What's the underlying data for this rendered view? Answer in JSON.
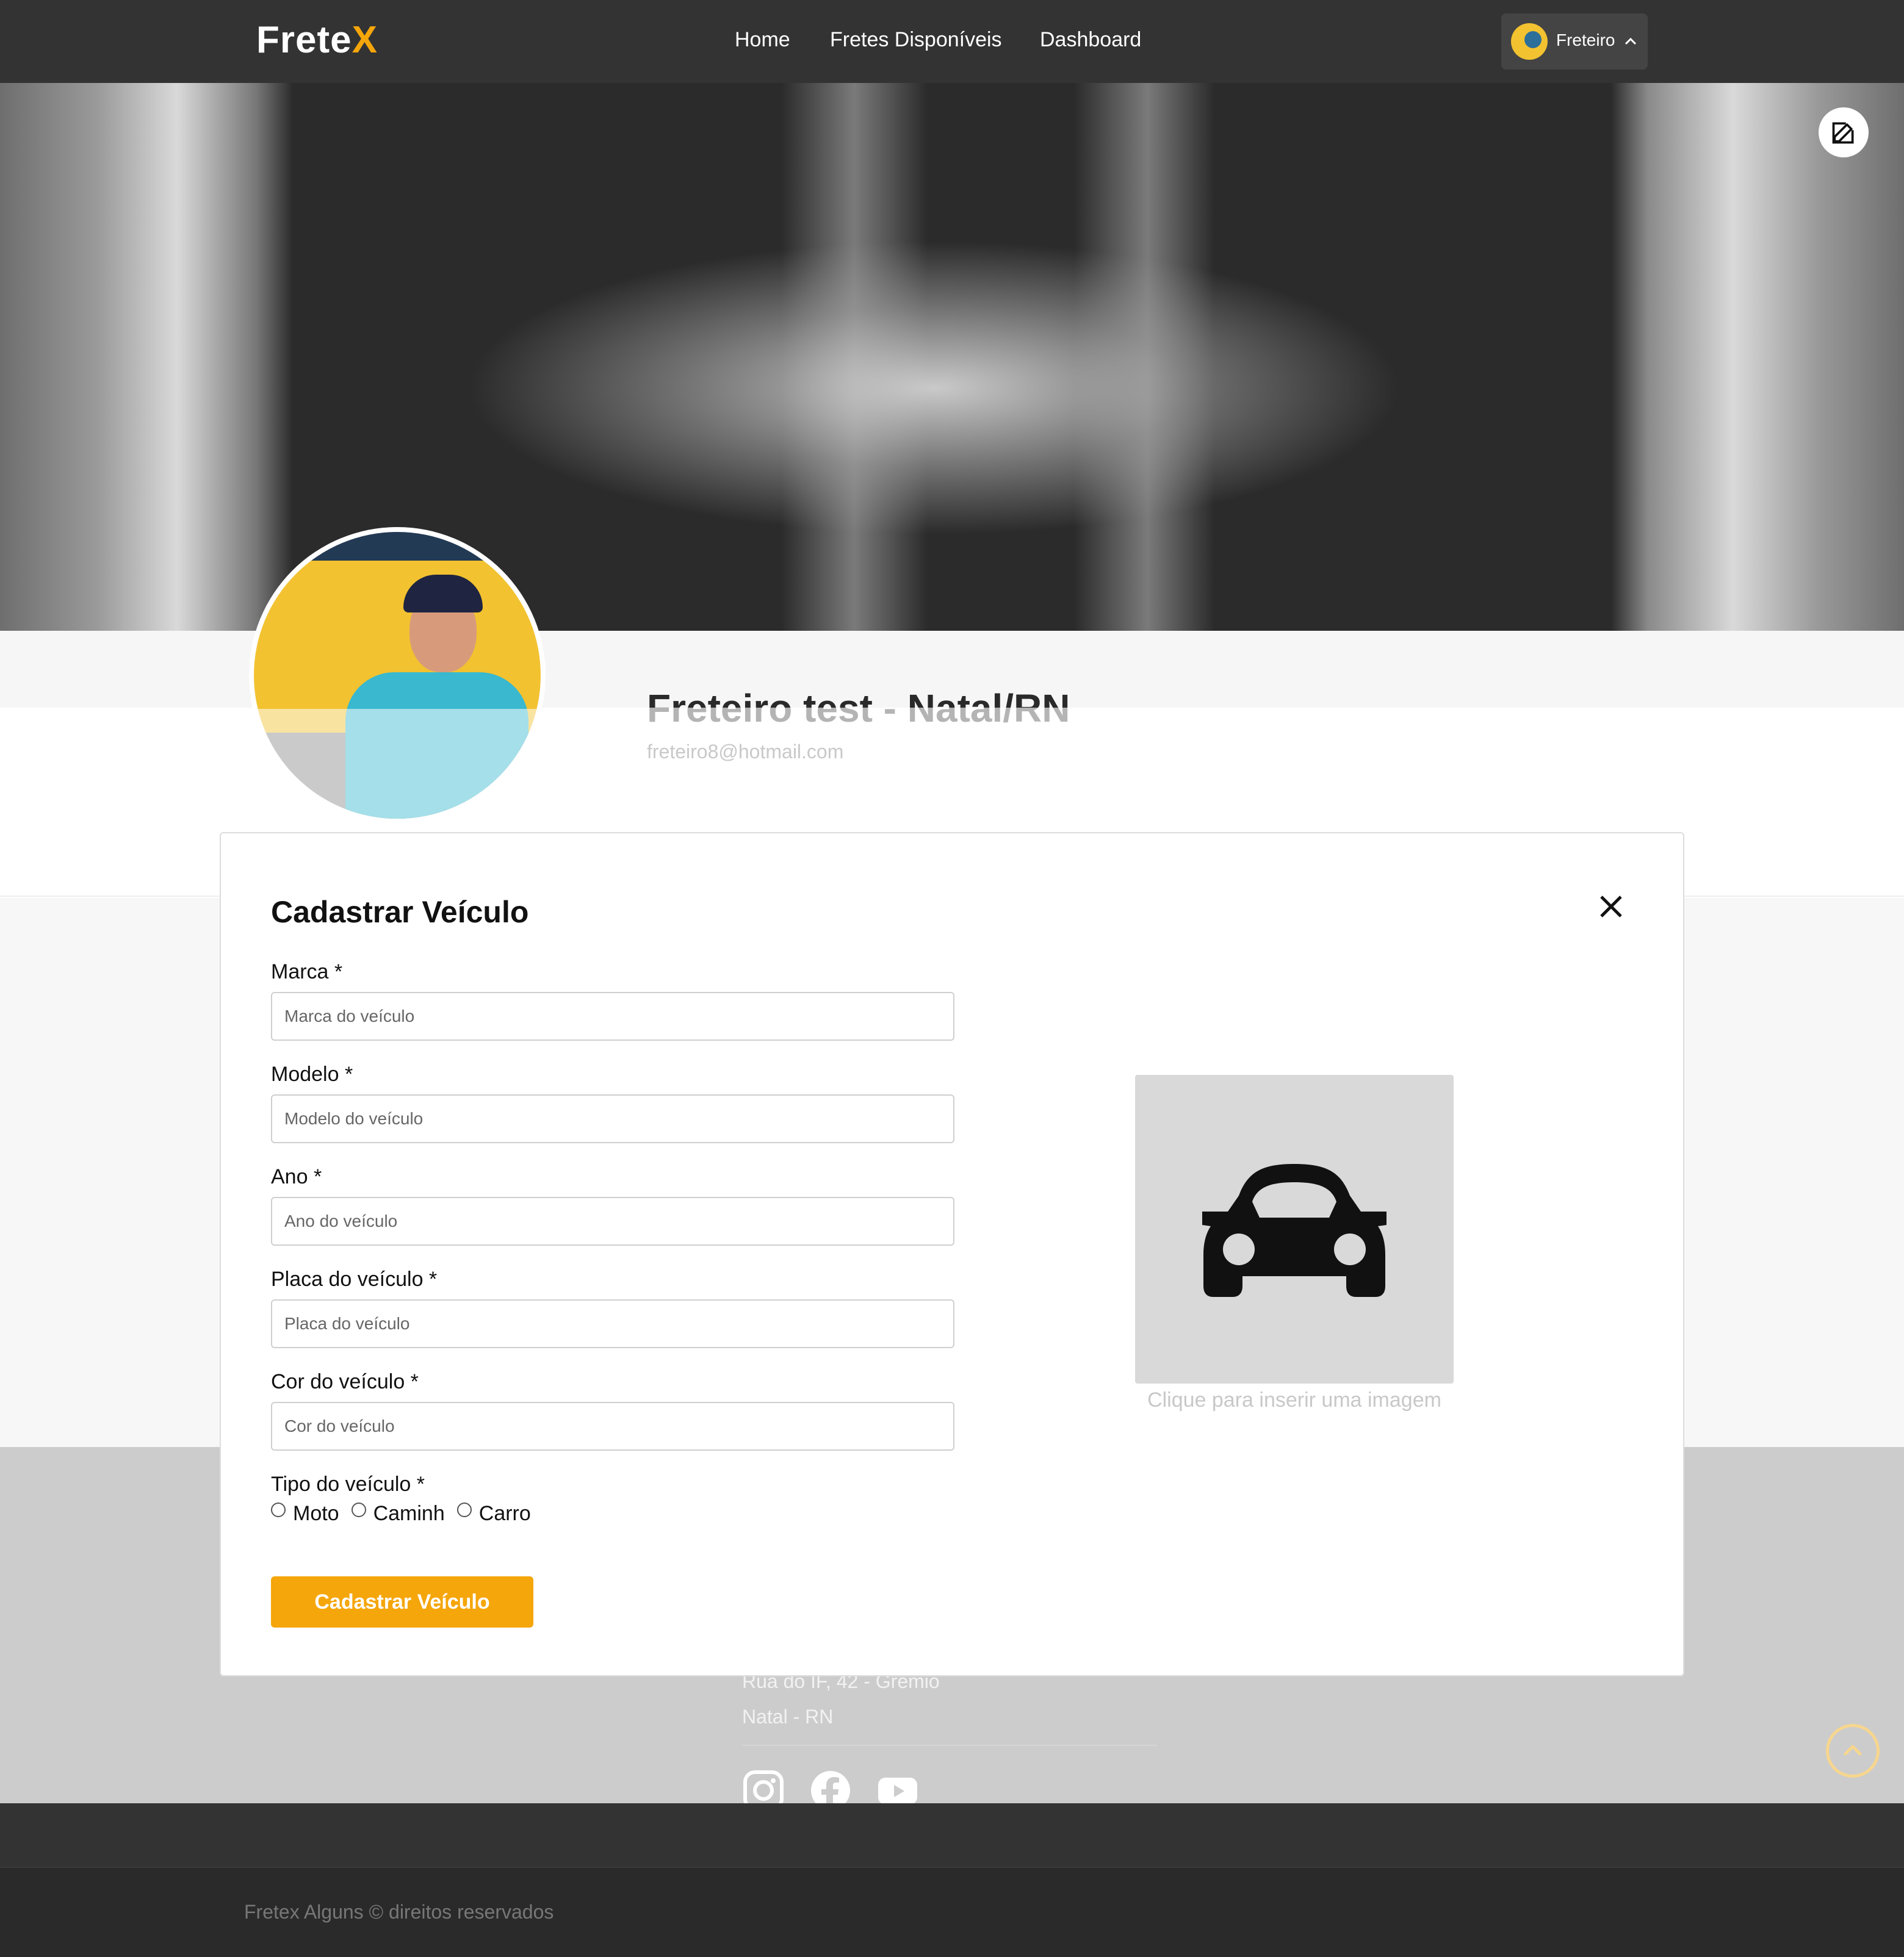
{
  "header": {
    "logo_main": "Frete",
    "logo_accent": "X",
    "nav": [
      "Home",
      "Fretes Disponíveis",
      "Dashboard"
    ],
    "user_label": "Freteiro"
  },
  "profile": {
    "name": "Freteiro test - Natal/RN",
    "email": "freteiro8@hotmail.com"
  },
  "modal": {
    "title": "Cadastrar Veículo",
    "fields": [
      {
        "label": "Marca *",
        "placeholder": "Marca do veículo",
        "value": ""
      },
      {
        "label": "Modelo *",
        "placeholder": "Modelo do veículo",
        "value": ""
      },
      {
        "label": "Ano *",
        "placeholder": "Ano do veículo",
        "value": ""
      },
      {
        "label": "Placa do veículo *",
        "placeholder": "Placa do veículo",
        "value": ""
      },
      {
        "label": "Cor do veículo *",
        "placeholder": "Cor do veículo",
        "value": ""
      }
    ],
    "vehicle_type": {
      "label": "Tipo do veículo *",
      "options": [
        "Moto",
        "Caminh",
        "Carro"
      ],
      "selected": null
    },
    "submit_label": "Cadastrar Veículo",
    "image_hint": "Clique para inserir uma imagem",
    "image_icon": "car-icon"
  },
  "footer": {
    "address_line1": "Rua do IF, 42 - Gremio",
    "address_line2": "Natal - RN",
    "social": [
      "instagram-icon",
      "facebook-icon",
      "youtube-icon"
    ],
    "copyright": "Fretex Alguns © direitos reservados"
  },
  "colors": {
    "accent": "#f5a60b",
    "header_bg": "#333333",
    "footer_bottom_bg": "#2a2a2a"
  }
}
